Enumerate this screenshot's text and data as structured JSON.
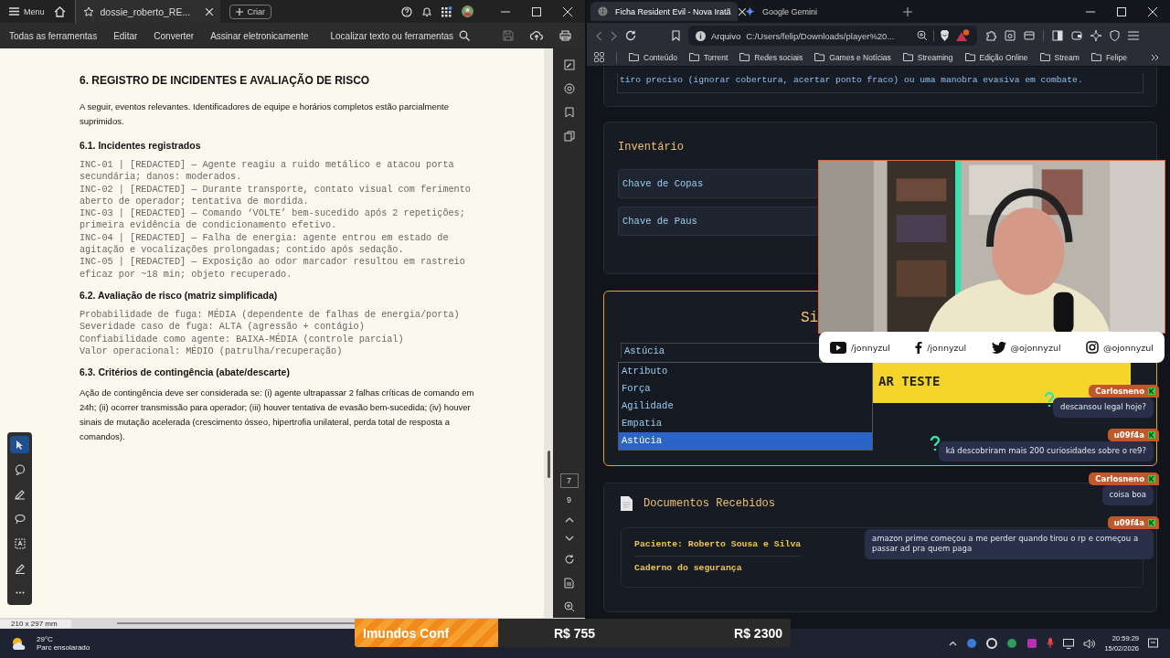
{
  "pdf_window": {
    "menu": "Menu",
    "tab": "dossie_roberto_RE...",
    "create": "Criar",
    "tools": [
      "Todas as ferramentas",
      "Editar",
      "Converter",
      "Assinar eletronicamente"
    ],
    "search": "Localizar texto ou ferramentas",
    "current_page": "7",
    "page_count": "9",
    "page_size": "210 x 297 mm",
    "tool_palette": [
      {
        "selected": true
      },
      {
        "selected": false
      },
      {
        "selected": false
      },
      {
        "selected": false
      },
      {
        "selected": false
      },
      {
        "selected": false
      },
      {
        "selected": false
      }
    ],
    "document": {
      "heading": "6. REGISTRO DE INCIDENTES E AVALIAÇÃO DE RISCO",
      "blocks": [
        {
          "kind": "para",
          "text": "A seguir, eventos relevantes. Identificadores de equipe e horários completos estão parcialmente suprimidos."
        },
        {
          "kind": "subheading",
          "text": "6.1. Incidentes registrados"
        },
        {
          "kind": "mono",
          "lines": [
            "INC-01 | [REDACTED] — Agente reagiu a ruido metálico e atacou porta secundária; danos: moderados.",
            "INC-02 | [REDACTED] — Durante transporte, contato visual com ferimento aberto de operador; tentativa de mordida.",
            "INC-03 | [REDACTED] — Comando ‘VOLTE’ bem-sucedido após 2 repetições; primeira evidência de condicionamento efetivo.",
            "INC-04 | [REDACTED] — Falha de energia: agente entrou em estado de agitação e vocalizações prolongadas; contido após sedação.",
            "INC-05 | [REDACTED] — Exposição ao odor marcador resultou em rastreio eficaz por ~18 min; objeto recuperado."
          ]
        },
        {
          "kind": "subheading",
          "text": "6.2. Avaliação de risco (matriz simplificada)"
        },
        {
          "kind": "mono",
          "lines": [
            "Probabilidade de fuga: MÉDIA (dependente de falhas de energia/porta)",
            "Severidade caso de fuga: ALTA (agressão + contágio)",
            "Confiabilidade como agente: BAIXA-MÉDIA (controle parcial)",
            "Valor operacional: MÉDIO (patrulha/recuperação)"
          ]
        },
        {
          "kind": "subheading",
          "text": "6.3. Critérios de contingência (abate/descarte)"
        },
        {
          "kind": "para",
          "text": "Ação de contingência deve ser considerada se: (i) agente ultrapassar 2 falhas críticas de comando em 24h; (ii) ocorrer transmissão para operador; (iii) houver tentativa de evasão bem-sucedida; (iv) houver sinais de mutação acelerada (crescimento ósseo, hipertrofia unilateral, perda total de resposta a comandos)."
        }
      ]
    }
  },
  "browser": {
    "tabs": [
      {
        "title": "Ficha Resident Evil - Nova Iratã",
        "selected": true
      },
      {
        "title": "Google Gemini",
        "selected": false
      }
    ],
    "address_label": "Arquivo",
    "url": "C:/Users/felip/Downloads/player%20...",
    "bookmarks": [
      "Conteúdo",
      "Torrent",
      "Redes sociais",
      "Games e Notícias",
      "Streaming",
      "Edição Online",
      "Stream",
      "Felipe"
    ],
    "page": {
      "ability_text": "tiro preciso (ignorar cobertura, acertar ponto fraco) ou uma manobra evasiva em combate.",
      "inventory_title": "Inventário",
      "inventory": [
        "Chave de Copas",
        "Chave de Paus"
      ],
      "test_title": "Si",
      "attribute_value": "Astúcia",
      "attribute_options": [
        {
          "label": "Atributo",
          "selected": false
        },
        {
          "label": "Força",
          "selected": false
        },
        {
          "label": "Agilidade",
          "selected": false
        },
        {
          "label": "Empatia",
          "selected": false
        },
        {
          "label": "Astúcia",
          "selected": true
        }
      ],
      "roll_button": "AR TESTE",
      "documents_title": "Documentos Recebidos",
      "documents": [
        "Paciente: Roberto Sousa e Silva",
        "Caderno do segurança"
      ]
    }
  },
  "webcam": {
    "kind": "picture",
    "socials": [
      {
        "kind": "youtube",
        "handle": "/jonnyzul"
      },
      {
        "kind": "facebook",
        "handle": "/jonnyzul"
      },
      {
        "kind": "twitter",
        "handle": "@ojonnyzul"
      },
      {
        "kind": "instagram",
        "handle": "@ojonnyzul"
      }
    ]
  },
  "chat": [
    {
      "user": "Carlosneno",
      "text": "descansou legal hoje?",
      "question": true
    },
    {
      "user": "u09f4a",
      "text": "ká descobriram mais 200 curiosidades sobre o re9?",
      "question": true
    },
    {
      "user": "Carlosneno",
      "text": "coisa boa",
      "question": false
    },
    {
      "user": "u09f4a",
      "text": "amazon prime começou a me perder quando tirou o rp e começou a passar ad pra quem paga",
      "question": false
    }
  ],
  "goal_bar": {
    "label": "Imundos Conf",
    "current": "R$ 755",
    "target": "R$ 2300",
    "level": 0.33
  },
  "taskbar": {
    "temperature": "29°C",
    "weather": "Parc ensolarado",
    "time": "20:59:29",
    "date": "15/02/2026"
  }
}
